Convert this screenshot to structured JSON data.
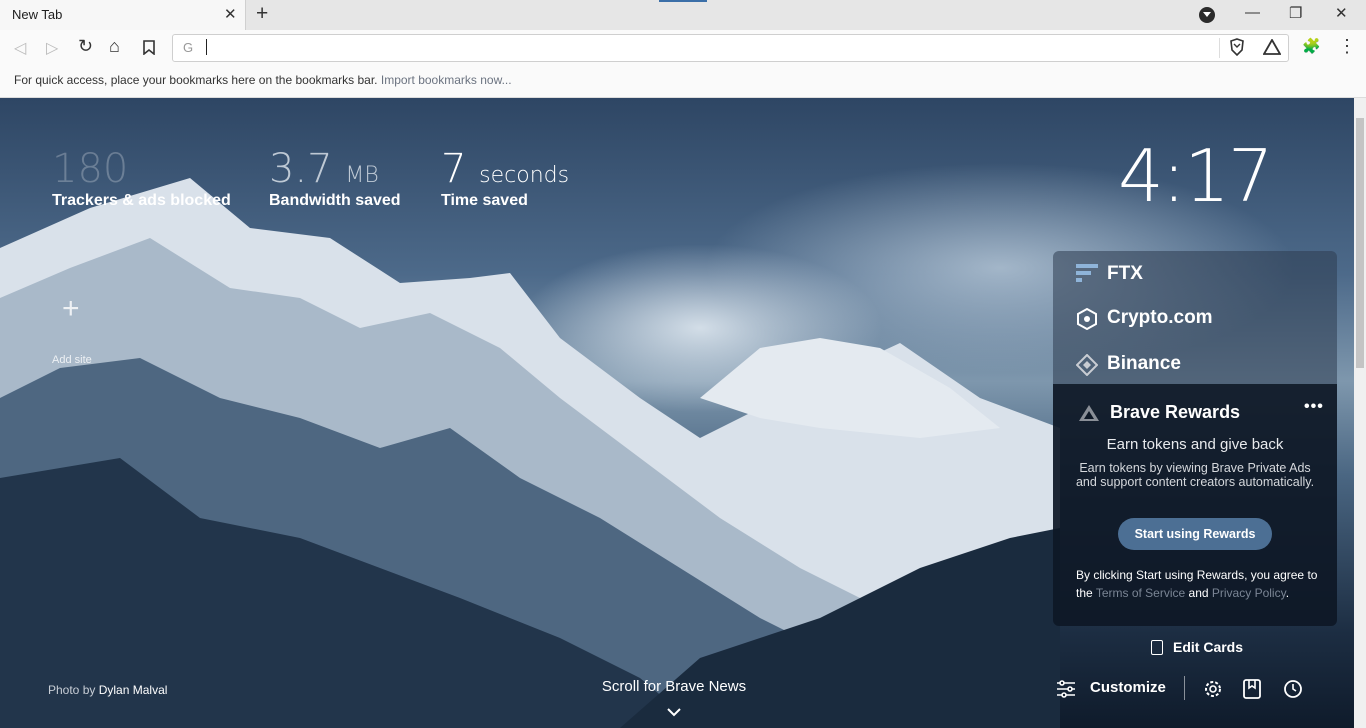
{
  "browser": {
    "tab": {
      "title": "New Tab",
      "close_glyph": "✕"
    },
    "new_tab_glyph": "+",
    "window_controls": {
      "minimize": "—",
      "restore": "❐",
      "close": "✕"
    },
    "toolbar": {
      "back": "◁",
      "forward": "▷",
      "reload": "↻",
      "home": "⌂",
      "bookmark": "🔖",
      "omnibox_icon": "G",
      "omnibox_value": "",
      "extensions": "🧩",
      "menu": "⋮"
    },
    "bookmarks_bar": {
      "text": "For quick access, place your bookmarks here on the bookmarks bar.",
      "link": "Import bookmarks now..."
    }
  },
  "stats": {
    "trackers": {
      "value": "180",
      "label": "Trackers & ads blocked"
    },
    "bandwidth": {
      "value": "3.7",
      "unit": "MB",
      "label": "Bandwidth saved"
    },
    "time": {
      "value": "7",
      "unit": "seconds",
      "label": "Time saved"
    }
  },
  "clock": "4:17",
  "top_sites": {
    "add_glyph": "+",
    "add_label": "Add site"
  },
  "cards": {
    "items": [
      {
        "name": "FTX",
        "icon": "ftx-icon"
      },
      {
        "name": "Crypto.com",
        "icon": "crypto-com-icon"
      },
      {
        "name": "Binance",
        "icon": "binance-icon"
      }
    ],
    "rewards": {
      "title": "Brave Rewards",
      "more": "•••",
      "heading": "Earn tokens and give back",
      "body": "Earn tokens by viewing Brave Private Ads and support content creators automatically.",
      "button": "Start using Rewards",
      "consent_pre": "By clicking Start using Rewards, you agree to the",
      "terms": "Terms of Service",
      "and": "and",
      "privacy": "Privacy Policy",
      "period": "."
    },
    "edit_label": "Edit Cards"
  },
  "footer": {
    "credit_prefix": "Photo by",
    "credit_name": "Dylan Malval",
    "scroll_news": "Scroll for Brave News",
    "customize": "Customize"
  },
  "colors": {
    "accent": "#4c6f94",
    "card_bg": "#0e1826"
  }
}
